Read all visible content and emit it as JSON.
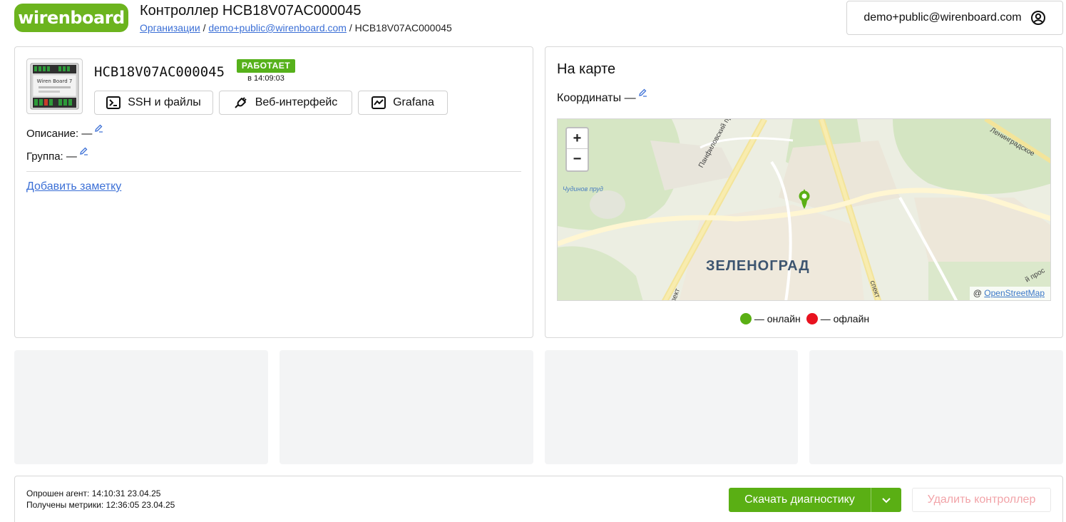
{
  "header": {
    "logo_text": "wirenboard",
    "title": "Контроллер HCB18V07AC000045",
    "breadcrumb": {
      "org": "Организации",
      "sep": " / ",
      "account": "demo+public@wirenboard.com",
      "current": "HCB18V07AC000045"
    },
    "user": "demo+public@wirenboard.com"
  },
  "device": {
    "thumb_label": "Wiren Board 7",
    "serial": "HCB18V07AC000045",
    "status": "РАБОТАЕТ",
    "status_time": "в 14:09:03",
    "buttons": {
      "ssh": "SSH и файлы",
      "web": "Веб-интерфейс",
      "grafana": "Grafana"
    },
    "description_label": "Описание: —",
    "group_label": "Группа: —",
    "add_note": "Добавить заметку"
  },
  "map": {
    "title": "На карте",
    "coords_label": "Координаты  —",
    "zoom_in": "+",
    "zoom_out": "−",
    "city": "ЗЕЛЕНОГРАД",
    "pond": "Чудинов пруд",
    "road_panfilov": "Панфиловский проспект",
    "road_leningrad": "Ленинградское",
    "road_partial_1": "пект",
    "road_partial_2": "спект",
    "road_partial_3": "й прос",
    "attribution_prefix": "@ ",
    "attribution_link": "OpenStreetMap",
    "legend_online": "— онлайн",
    "legend_offline": "— офлайн",
    "colors": {
      "online": "#5aaf14",
      "offline": "#e8121f"
    }
  },
  "footer": {
    "agent_polled": "Опрошен агент: 14:10:31 23.04.25",
    "metrics_received": "Получены метрики: 12:36:05 23.04.25",
    "download_button": "Скачать диагностику",
    "delete_button": "Удалить контроллер"
  }
}
